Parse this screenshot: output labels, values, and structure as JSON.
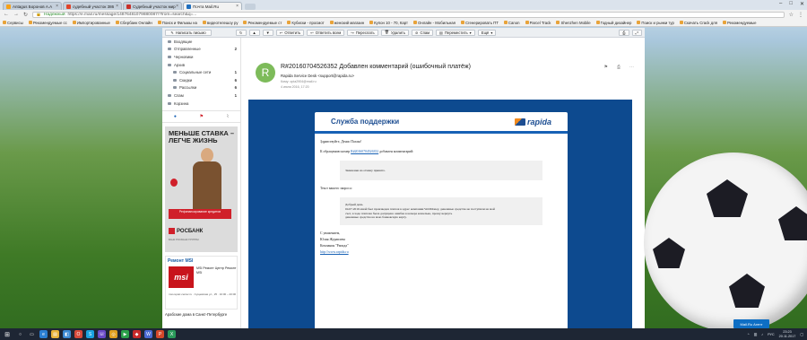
{
  "browser": {
    "tabs": [
      {
        "title": "Antagus Боронов А.А",
        "color": "#f7a21a",
        "active": false
      },
      {
        "title": "судебный участок 386",
        "color": "#e0442a",
        "active": false
      },
      {
        "title": "Судебный участок мир",
        "color": "#c8302a",
        "active": false
      },
      {
        "title": "Почта Mail.Ru",
        "color": "#1f6fbf",
        "active": true
      }
    ],
    "window_controls": [
      "–",
      "□",
      "✕"
    ],
    "secure_label": "Надежный",
    "url": "https://e.mail.ru/message/14876481079880087/?from=search&q=...",
    "bookmarks": [
      "Сервисы",
      "Рекомендуемые сс",
      "Импортированные",
      "Сбербанк Онлайн",
      "Поиск и Фильмы на",
      "видеотелешоу ру",
      "Рекомендуемые ст",
      "Кубиски - просмот",
      "женский магазин",
      "Купон 10 - 70, Карт",
      "Онлайн - Мобильная",
      "Сгенерировать ПТ",
      "Canon",
      "Parcel Track",
      "Shenzhen Mobile",
      "Годный дизайнер",
      "Поиск и рынки тур",
      "Скачать Crack для",
      "Рекомендуемые"
    ]
  },
  "toolbar": {
    "compose": "Написать письмо",
    "reply": "Ответить",
    "reply_all": "Ответить всем",
    "forward": "Переслать",
    "delete": "Удалить",
    "spam": "Спам",
    "move": "Переместить",
    "more": "Ещё"
  },
  "folders": [
    {
      "name": "Входящие",
      "count": "",
      "sub": false
    },
    {
      "name": "Отправленные",
      "count": "2",
      "sub": false
    },
    {
      "name": "Черновики",
      "count": "",
      "sub": false
    },
    {
      "name": "Архив",
      "count": "",
      "sub": false
    },
    {
      "name": "Социальные сети",
      "count": "1",
      "sub": true
    },
    {
      "name": "Скидки",
      "count": "6",
      "sub": true
    },
    {
      "name": "Рассылки",
      "count": "6",
      "sub": true
    },
    {
      "name": "Спам",
      "count": "1",
      "sub": false
    },
    {
      "name": "Корзина",
      "count": "",
      "sub": false
    }
  ],
  "ads": {
    "bank_headline": "МЕНЬШЕ СТАВКА – ЛЕГЧЕ ЖИЗНЬ",
    "bank_promo": "Рефинансирование кредитов",
    "bank_name": "РОСБАНК",
    "bank_sub": "БАНК РОСБАНК ГРУППЫ",
    "msi_title": "Ремонт MSI",
    "msi_logo": "msi",
    "msi_desc": "MSI Ремонт Центр Ремонт MSI",
    "msi_addr": "msi-repair-center.ru · Сущевская ул., 25 · 10:00 – 20:00",
    "text_ad": "Арабские дома в Санкт-Петербурге"
  },
  "message": {
    "avatar_letter": "R",
    "subject": "R#20160704526352 Добавлен комментарий (ошибочный платёж)",
    "from": "Rapida Service Desk <support@rapida.ru>",
    "to": "Кому: opia2904@mail.ru",
    "date": "4 июля 2016, 17:20",
    "body": {
      "title": "Служба поддержки",
      "brand": "rapida",
      "greeting": "Здравствуйте, Денис Пахин!",
      "ticket_line_pre": "К обращению номер",
      "ticket_number": "R#20160704526352",
      "ticket_line_post": "добавлен комментарий:",
      "comment": "Заявление на отмену принято.",
      "req_label": "Текст вашего запроса:",
      "request_lines": [
        "Добрый день",
        "04.07.2016 мной был произведен платеж в адрес компании WebMoney, денежные средства не поступили на мой",
        "счет, в ходе платежа была допущена ошибка в номере кошелька, прошу вернуть",
        "денежные средства на мою банковскую карту."
      ],
      "sign1": "С уважением,",
      "sign2": "Юлия Журавлева",
      "sign3": "Компания \"Рапида\"",
      "link": "http://www.rapida.ru"
    }
  },
  "notify": "Mail.Ru Агент",
  "taskbar": {
    "time": "23:23",
    "date": "20.11.2017",
    "lang": "РУС"
  }
}
